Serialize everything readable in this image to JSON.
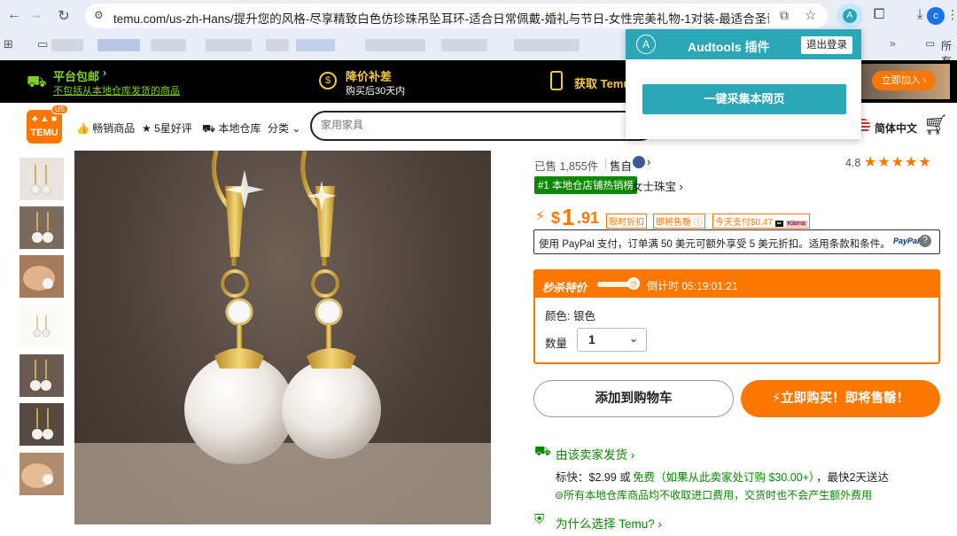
{
  "browser": {
    "url": "temu.com/us-zh-Hans/提升您的风格-尽享精致白色仿珍珠吊坠耳环-适合日常佩戴-婚礼与节日-女性完美礼物-1对装-最适合圣诞季-...",
    "extension_badge": "A",
    "profile_initial": "c",
    "bookmark_folder": "所有"
  },
  "promo": {
    "item1_title": "平台包邮",
    "item1_sub": "不包括从本地仓库发货的商品",
    "item2_title": "降价补差",
    "item2_sub": "购买后30天内",
    "item3_title": "获取 Temu",
    "join_label": "立即加入"
  },
  "header": {
    "logo_text": "TEMU",
    "us_tag": "US",
    "nav": [
      "畅销商品",
      "5星好评",
      "本地仓库",
      "分类"
    ],
    "search_placeholder": "家用家具",
    "language": "简体中文"
  },
  "popup": {
    "logo_letter": "A",
    "title": "Audtools 插件",
    "logout_label": "退出登录",
    "collect_button": "一键采集本网页"
  },
  "product": {
    "sold": "已售 1,855件",
    "seller_prefix": "售自",
    "rating": "4.8",
    "rank_badge": "#1 本地仓店铺热销榜",
    "category": "女士珠宝",
    "currency": "$",
    "price_int": "1",
    "price_dec": ".91",
    "tag1": "限时折扣",
    "tag2": "即将售罄",
    "tag3": "今天支付$0.47",
    "paypal_text": "使用 PayPal 支付，订单满 50 美元可额外享受 5 美元折扣。适用条款和条件。",
    "paypal_logo": "PayPal",
    "flash_label": "秒杀特价",
    "countdown": "倒计时 05:19:01:21",
    "color_label": "颜色: 银色",
    "qty_label": "数量",
    "qty_value": "1",
    "add_cart": "添加到购物车",
    "buy_now": "立即购买！即将售罄！",
    "shipping_title": "由该卖家发货",
    "shipping_line": "标快：$2.99 或",
    "shipping_free": "免费（如果从此卖家处订购 $30.00+）",
    "shipping_eta": "，最快2天送达",
    "shipping_note": "所有本地仓库商品均不收取进口费用，交货时也不会产生额外费用",
    "why_temu": "为什么选择 Temu?"
  },
  "colors": {
    "brand_orange": "#fb7701",
    "teal": "#2aa6b7",
    "green": "#0a8800"
  }
}
